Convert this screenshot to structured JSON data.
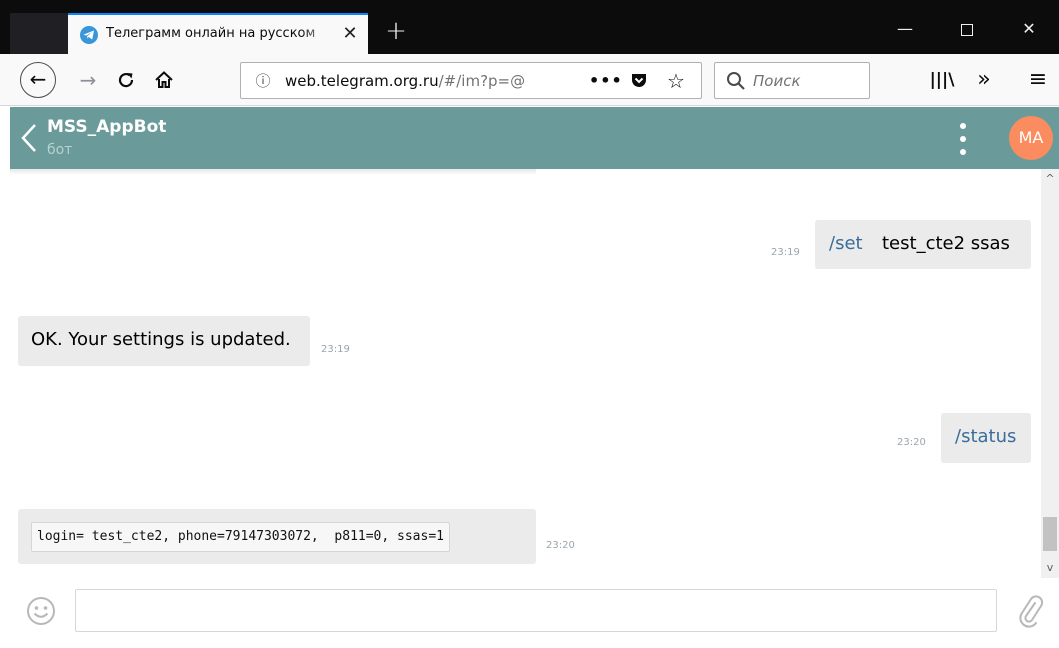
{
  "browser": {
    "tab": {
      "title": "Телеграмм онлайн на русском"
    },
    "url": {
      "prefix": "",
      "host": "web.telegram.org.ru",
      "path": "/#/im?p=@"
    },
    "search": {
      "placeholder": "Поиск"
    },
    "colors": {
      "tab_accent": "#0a84ff",
      "tabbar_bg": "#0c0c0d"
    }
  },
  "chat": {
    "title": "MSS_AppBot",
    "subtitle": "бот",
    "avatar_initials": "MA",
    "colors": {
      "header_bg": "#6a9b9a",
      "avatar_bg": "#fb8c5f",
      "command": "#3a6d99",
      "bubble": "#ebebeb"
    },
    "messages": [
      {
        "direction": "out",
        "command": "/set",
        "text": "test_cte2 ssas",
        "time": "23:19"
      },
      {
        "direction": "in",
        "text": "OK. Your settings is updated.",
        "time": "23:19"
      },
      {
        "direction": "out",
        "command": "/status",
        "text": "",
        "time": "23:20"
      },
      {
        "direction": "in",
        "code": "login= test_cte2, phone=79147303072,  p811=0, ssas=1",
        "time": "23:20"
      }
    ]
  },
  "composer": {
    "placeholder": ""
  }
}
